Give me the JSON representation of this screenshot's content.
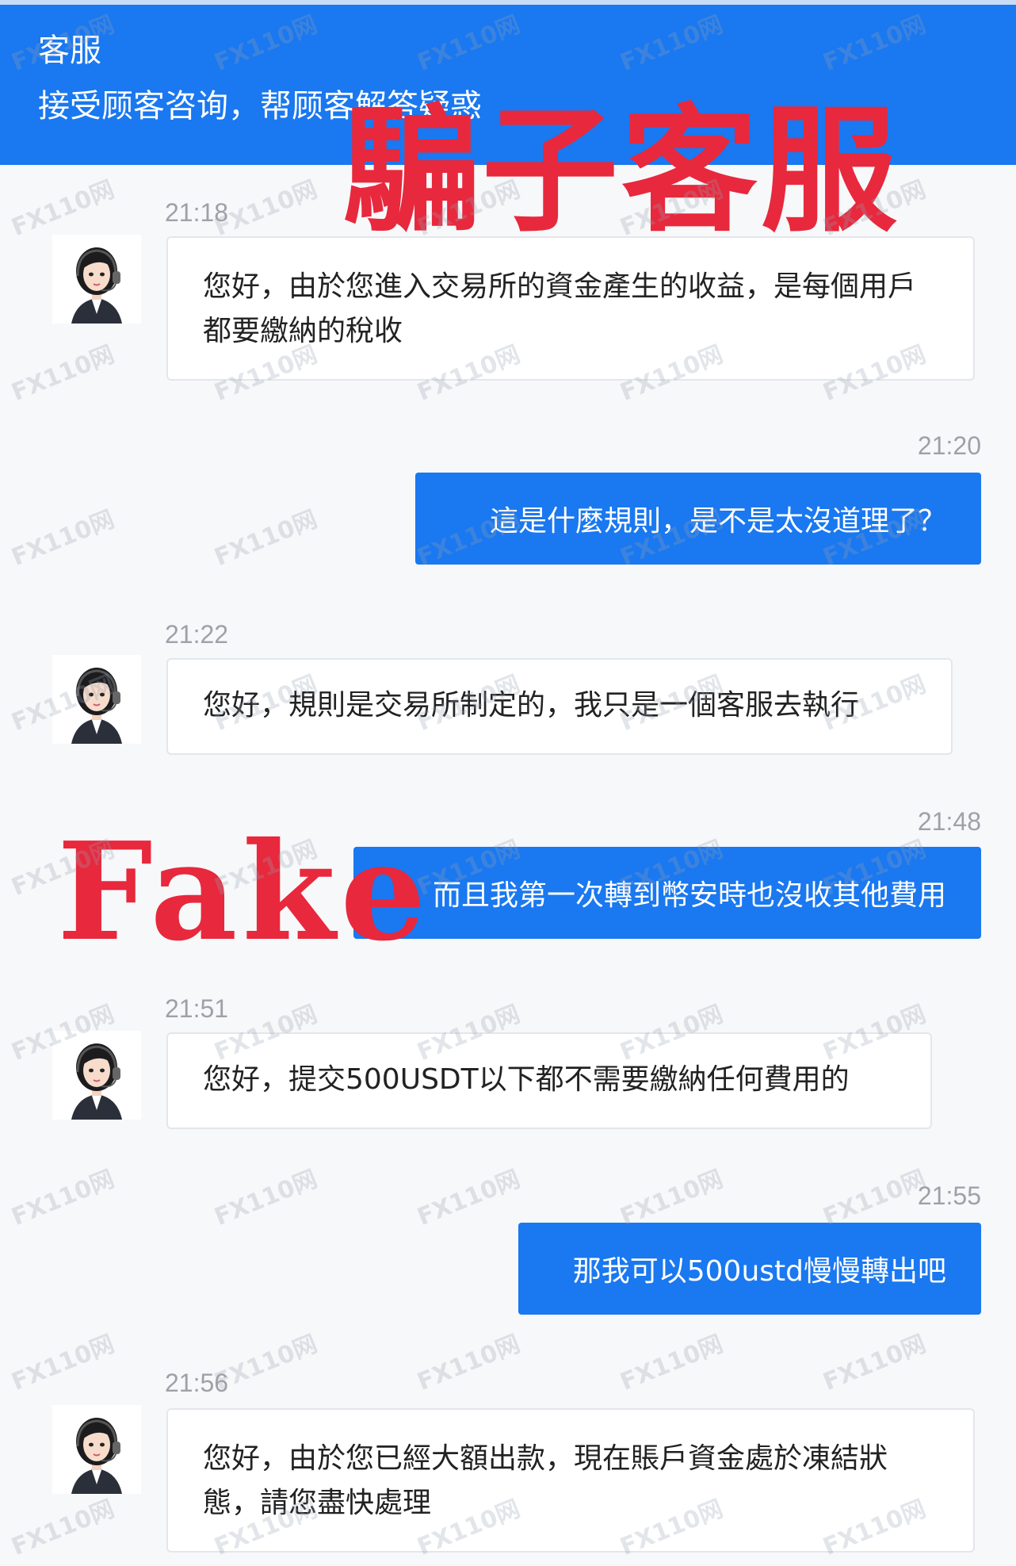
{
  "header": {
    "title": "客服",
    "subtitle": "接受顾客咨询，帮顾客解答疑惑"
  },
  "overlays": {
    "scam_stamp": "騙子客服",
    "fake_stamp": "Fake",
    "watermark": "FX110网"
  },
  "messages": [
    {
      "time": "21:18",
      "from": "agent",
      "text": "您好，由於您進入交易所的資金產生的收益，是每個用戶都要繳納的稅收"
    },
    {
      "time": "21:20",
      "from": "user",
      "text": "這是什麼規則，是不是太沒道理了？"
    },
    {
      "time": "21:22",
      "from": "agent",
      "text": "您好，規則是交易所制定的，我只是一個客服去執行"
    },
    {
      "time": "21:48",
      "from": "user",
      "text": "而且我第一次轉到幣安時也沒收其他費用"
    },
    {
      "time": "21:51",
      "from": "agent",
      "text": "您好，提交500USDT以下都不需要繳納任何費用的"
    },
    {
      "time": "21:55",
      "from": "user",
      "text": "那我可以500ustd慢慢轉出吧"
    },
    {
      "time": "21:56",
      "from": "agent",
      "text": "您好，由於您已經大額出款，現在賬戶資金處於凍結狀態，請您盡快處理"
    }
  ],
  "colors": {
    "header_bg": "#1a78f0",
    "user_bubble": "#1a78f0",
    "stamp_red": "#e8283c",
    "page_bg": "#f7f8fa"
  }
}
